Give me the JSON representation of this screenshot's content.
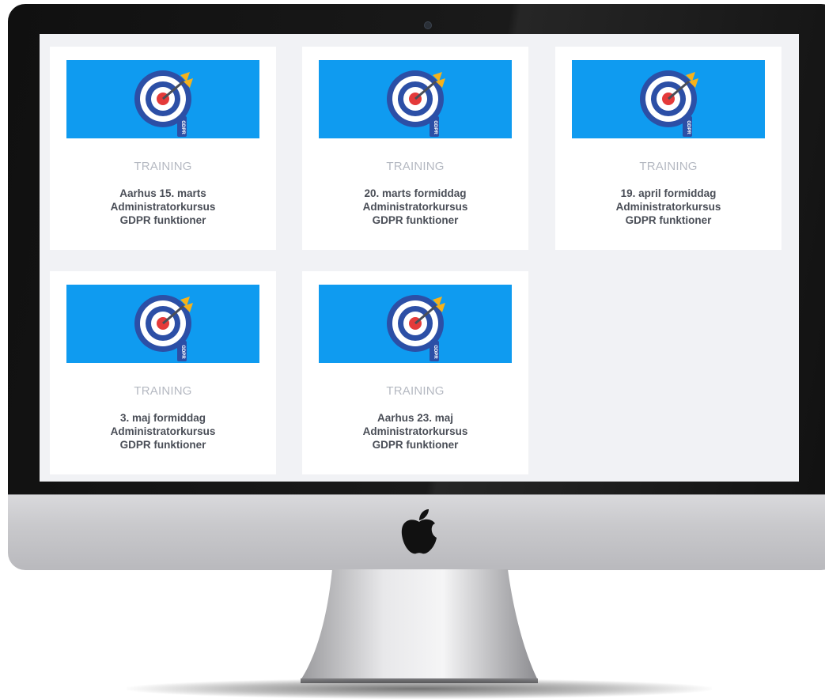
{
  "colors": {
    "card_image_bg": "#0f9bf0",
    "category_text": "#b5b9c2",
    "title_text": "#4a4e57",
    "screen_bg": "#f1f2f5"
  },
  "icons": {
    "card_image": "gdpr-target-arrow-icon",
    "monitor_logo": "apple-logo-icon"
  },
  "cards": [
    {
      "category": "TRAINING",
      "title_lines": [
        "Aarhus 15. marts",
        "Administratorkursus",
        "GDPR funktioner"
      ],
      "image_tag": "GDPR"
    },
    {
      "category": "TRAINING",
      "title_lines": [
        "20. marts formiddag",
        "Administratorkursus",
        "GDPR funktioner"
      ],
      "image_tag": "GDPR"
    },
    {
      "category": "TRAINING",
      "title_lines": [
        "19. april formiddag",
        "Administratorkursus",
        "GDPR funktioner"
      ],
      "image_tag": "GDPR"
    },
    {
      "category": "TRAINING",
      "title_lines": [
        "3. maj formiddag",
        "Administratorkursus",
        "GDPR funktioner"
      ],
      "image_tag": "GDPR"
    },
    {
      "category": "TRAINING",
      "title_lines": [
        "Aarhus 23. maj",
        "Administratorkursus",
        "GDPR funktioner"
      ],
      "image_tag": "GDPR"
    }
  ]
}
